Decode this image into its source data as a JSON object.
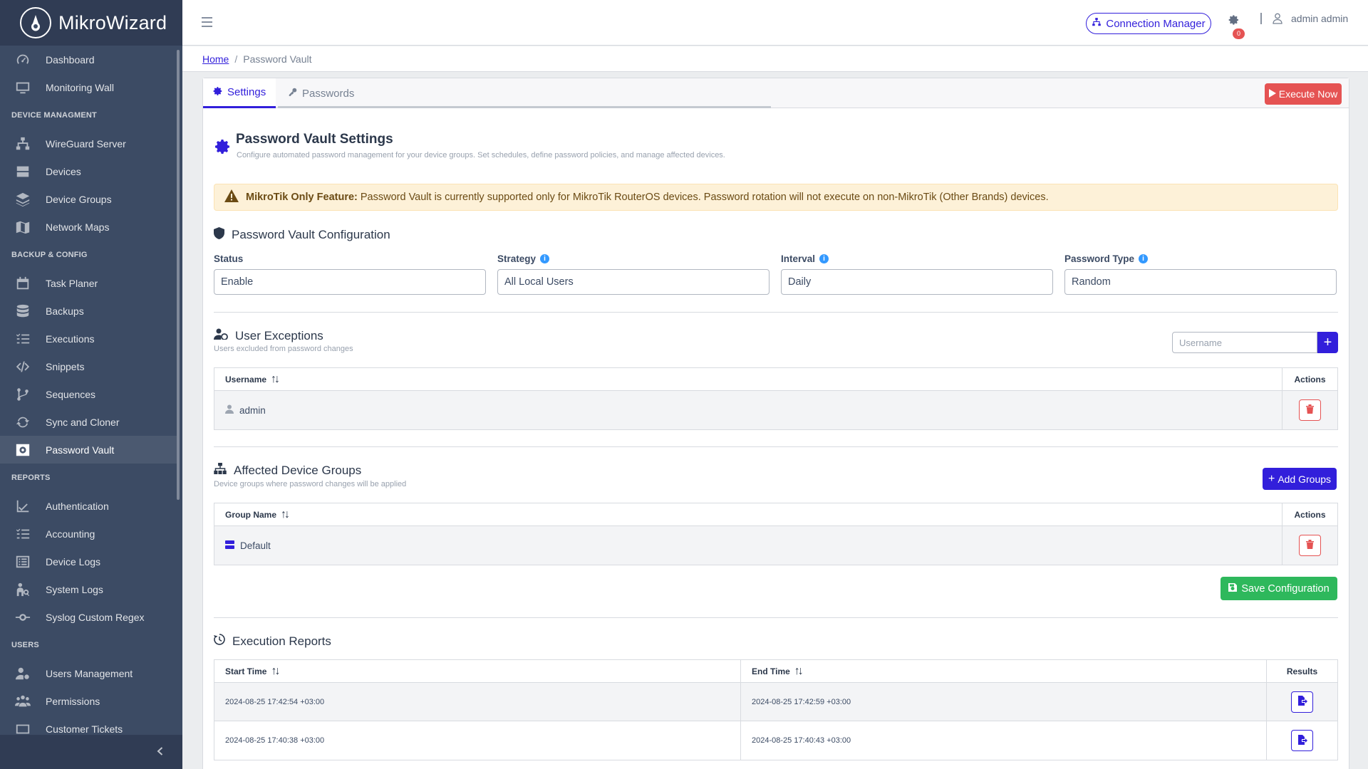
{
  "app": {
    "brand": "MikroWizard"
  },
  "sidebar": {
    "items": [
      {
        "label": "Dashboard",
        "icon": "speedometer-icon"
      },
      {
        "label": "Monitoring Wall",
        "icon": "monitor-icon"
      }
    ],
    "section_device": "DEVICE MANAGMENT",
    "device_items": [
      {
        "label": "WireGuard Server",
        "icon": "sitemap-icon"
      },
      {
        "label": "Devices",
        "icon": "storage-icon"
      },
      {
        "label": "Device Groups",
        "icon": "layers-icon"
      },
      {
        "label": "Network Maps",
        "icon": "map-icon"
      }
    ],
    "section_backup": "BACKUP & CONFIG",
    "backup_items": [
      {
        "label": "Task Planer",
        "icon": "calendar-icon"
      },
      {
        "label": "Backups",
        "icon": "database-icon"
      },
      {
        "label": "Executions",
        "icon": "list-check-icon"
      },
      {
        "label": "Snippets",
        "icon": "code-icon"
      },
      {
        "label": "Sequences",
        "icon": "branch-icon"
      },
      {
        "label": "Sync and Cloner",
        "icon": "sync-icon"
      },
      {
        "label": "Password Vault",
        "icon": "vault-icon"
      }
    ],
    "section_reports": "REPORTS",
    "report_items": [
      {
        "label": "Authentication",
        "icon": "chart-check-icon"
      },
      {
        "label": "Accounting",
        "icon": "list-check-icon"
      },
      {
        "label": "Device Logs",
        "icon": "list-icon"
      },
      {
        "label": "System Logs",
        "icon": "user-search-icon"
      },
      {
        "label": "Syslog Custom Regex",
        "icon": "commit-icon"
      }
    ],
    "section_users": "USERS",
    "user_items": [
      {
        "label": "Users Management",
        "icon": "user-gear-icon"
      },
      {
        "label": "Permissions",
        "icon": "people-icon"
      },
      {
        "label": "Customer Tickets",
        "icon": "ticket-icon"
      }
    ],
    "active": "Password Vault"
  },
  "header": {
    "connection_manager": "Connection Manager",
    "notification_count": "0",
    "user": "admin admin"
  },
  "breadcrumb": {
    "home": "Home",
    "current": "Password Vault"
  },
  "tabs": {
    "settings": "Settings",
    "passwords": "Passwords",
    "execute": "Execute Now"
  },
  "settings": {
    "title": "Password Vault Settings",
    "subtitle": "Configure automated password management for your device groups. Set schedules, define password policies, and manage affected devices.",
    "alert_bold": "MikroTik Only Feature:",
    "alert_text": "Password Vault is currently supported only for MikroTik RouterOS devices. Password rotation will not execute on non-MikroTik (Other Brands) devices.",
    "config_title": "Password Vault Configuration",
    "fields": {
      "status_label": "Status",
      "status_value": "Enable",
      "strategy_label": "Strategy",
      "strategy_value": "All Local Users",
      "interval_label": "Interval",
      "interval_value": "Daily",
      "ptype_label": "Password Type",
      "ptype_value": "Random"
    }
  },
  "exceptions": {
    "title": "User Exceptions",
    "subtitle": "Users excluded from password changes",
    "input_placeholder": "Username",
    "col_username": "Username",
    "col_actions": "Actions",
    "rows": [
      {
        "username": "admin"
      }
    ]
  },
  "groups": {
    "title": "Affected Device Groups",
    "subtitle": "Device groups where password changes will be applied",
    "add_button": "Add Groups",
    "col_group": "Group Name",
    "col_actions": "Actions",
    "rows": [
      {
        "name": "Default"
      }
    ],
    "save_button": "Save Configuration"
  },
  "reports": {
    "title": "Execution Reports",
    "col_start": "Start Time",
    "col_end": "End Time",
    "col_results": "Results",
    "rows": [
      {
        "start": "2024-08-25 17:42:54 +03:00",
        "end": "2024-08-25 17:42:59 +03:00"
      },
      {
        "start": "2024-08-25 17:40:38 +03:00",
        "end": "2024-08-25 17:40:43 +03:00"
      }
    ]
  },
  "colors": {
    "primary": "#321fdb",
    "danger": "#e55353",
    "success": "#2eb85c",
    "sidebar": "#3c4b64"
  }
}
